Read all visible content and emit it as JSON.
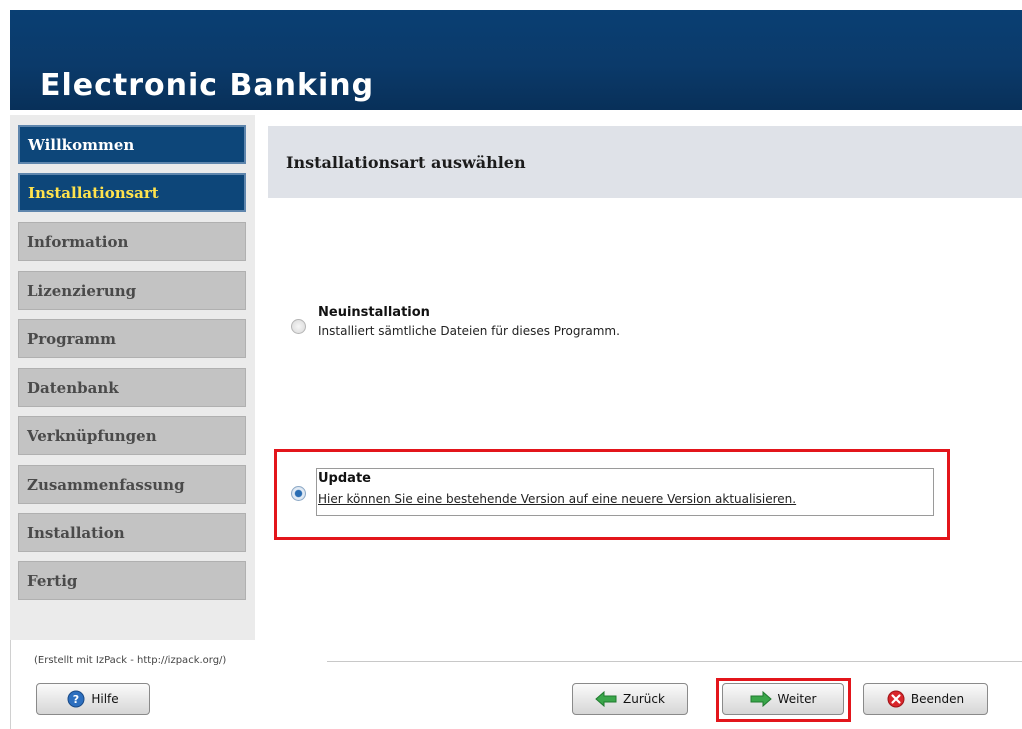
{
  "app": {
    "title": "Electronic Banking"
  },
  "sidebar": {
    "steps": [
      {
        "label": "Willkommen",
        "state": "done"
      },
      {
        "label": "Installationsart",
        "state": "current"
      },
      {
        "label": "Information",
        "state": "pending"
      },
      {
        "label": "Lizenzierung",
        "state": "pending"
      },
      {
        "label": "Programm",
        "state": "pending"
      },
      {
        "label": "Datenbank",
        "state": "pending"
      },
      {
        "label": "Verknüpfungen",
        "state": "pending"
      },
      {
        "label": "Zusammenfassung",
        "state": "pending"
      },
      {
        "label": "Installation",
        "state": "pending"
      },
      {
        "label": "Fertig",
        "state": "pending"
      }
    ]
  },
  "panel": {
    "title": "Installationsart auswählen",
    "options": [
      {
        "title": "Neuinstallation",
        "description": "Installiert sämtliche Dateien für dieses Programm.",
        "selected": false
      },
      {
        "title": "Update",
        "description": "Hier können Sie eine bestehende Version auf eine neuere Version aktualisieren.",
        "selected": true
      }
    ]
  },
  "footer": {
    "credit": "(Erstellt mit IzPack - http://izpack.org/)",
    "help_label": "Hilfe",
    "back_label": "Zurück",
    "next_label": "Weiter",
    "quit_label": "Beenden"
  },
  "colors": {
    "header_bg": "#0b3a6a",
    "step_done_bg": "#0d4679",
    "step_current_text": "#ffe34d",
    "step_pending_bg": "#c3c3c3",
    "highlight_red": "#e3151b"
  },
  "icons": {
    "help": "help-icon",
    "back": "arrow-left-icon",
    "next": "arrow-right-icon",
    "quit": "close-icon"
  }
}
